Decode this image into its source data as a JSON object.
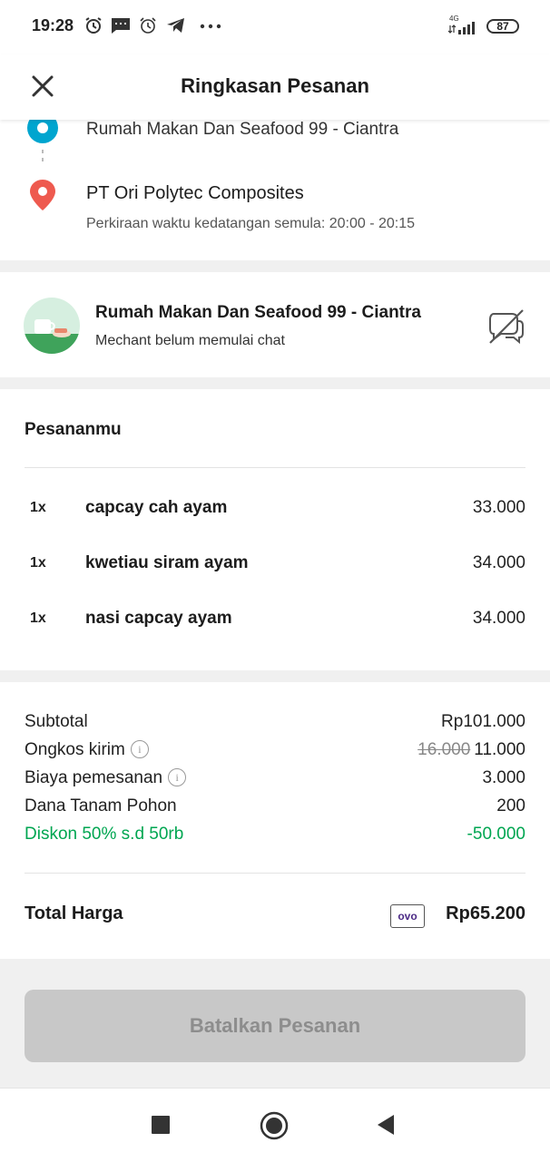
{
  "status_bar": {
    "time": "19:28",
    "network": "4G",
    "battery": "87"
  },
  "header": {
    "title": "Ringkasan Pesanan"
  },
  "route": {
    "origin": "Rumah Makan Dan Seafood 99 - Ciantra",
    "destination": "PT Ori Polytec Composites",
    "eta": "Perkiraan waktu kedatangan semula: 20:00 - 20:15"
  },
  "merchant": {
    "name": "Rumah Makan Dan Seafood 99 - Ciantra",
    "status": "Mechant belum memulai chat"
  },
  "order": {
    "title": "Pesananmu",
    "items": [
      {
        "qty": "1x",
        "name": "capcay cah ayam",
        "price": "33.000"
      },
      {
        "qty": "1x",
        "name": "kwetiau siram ayam",
        "price": "34.000"
      },
      {
        "qty": "1x",
        "name": "nasi capcay ayam",
        "price": "34.000"
      }
    ]
  },
  "summary": {
    "subtotal_label": "Subtotal",
    "subtotal_value": "Rp101.000",
    "delivery_label": "Ongkos kirim",
    "delivery_original": "16.000",
    "delivery_value": "11.000",
    "order_fee_label": "Biaya pemesanan",
    "order_fee_value": "3.000",
    "tree_label": "Dana Tanam Pohon",
    "tree_value": "200",
    "discount_label": "Diskon 50% s.d 50rb",
    "discount_value": "-50.000",
    "total_label": "Total Harga",
    "payment_method": "ovo",
    "total_value": "Rp65.200"
  },
  "actions": {
    "cancel_label": "Batalkan Pesanan"
  },
  "colors": {
    "green": "#00a651",
    "origin_blue": "#00a5cf",
    "pin_red": "#ee5a4f"
  }
}
